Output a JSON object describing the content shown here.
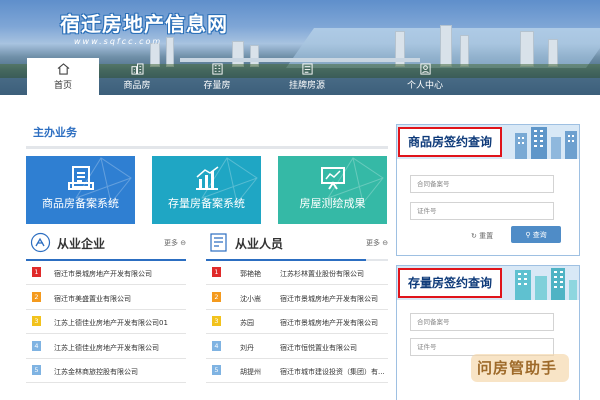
{
  "header": {
    "site_title": "宿迁房地产信息网",
    "site_url": "www.sqfcc.com",
    "nav": [
      {
        "label": "首页",
        "icon": "home-icon",
        "active": true
      },
      {
        "label": "商品房",
        "icon": "building-icon",
        "active": false
      },
      {
        "label": "存量房",
        "icon": "apartment-icon",
        "active": false
      },
      {
        "label": "挂牌房源",
        "icon": "listing-icon",
        "active": false
      },
      {
        "label": "个人中心",
        "icon": "user-icon",
        "active": false
      }
    ]
  },
  "main": {
    "section_title": "主办业务",
    "tiles": [
      {
        "label": "商品房备案系统",
        "icon": "document-icon",
        "color": "#2f7fd2"
      },
      {
        "label": "存量房备案系统",
        "icon": "bar-chart-icon",
        "color": "#1fa6c4"
      },
      {
        "label": "房屋测绘成果",
        "icon": "monitor-chart-icon",
        "color": "#35b9a6"
      }
    ]
  },
  "enterprises": {
    "title": "从业企业",
    "more_label": "更多",
    "rows": [
      {
        "rank": "1",
        "name": "宿迁市景城房地产开发有限公司"
      },
      {
        "rank": "2",
        "name": "宿迁市美盛置业有限公司"
      },
      {
        "rank": "3",
        "name": "江苏上德佳业房地产开发有限公司01"
      },
      {
        "rank": "4",
        "name": "江苏上德佳业房地产开发有限公司"
      },
      {
        "rank": "5",
        "name": "江苏金林商旅控股有限公司"
      }
    ]
  },
  "personnel": {
    "title": "从业人员",
    "more_label": "更多",
    "rows": [
      {
        "rank": "1",
        "person": "郭艳艳",
        "company": "江苏杉林置业股份有限公司"
      },
      {
        "rank": "2",
        "person": "沈小嵩",
        "company": "宿迁市景城房地产开发有限公司"
      },
      {
        "rank": "3",
        "person": "苏园",
        "company": "宿迁市景城房地产开发有限公司"
      },
      {
        "rank": "4",
        "person": "刘丹",
        "company": "宿迁市恒悦置业有限公司"
      },
      {
        "rank": "5",
        "person": "胡提州",
        "company": "宿迁市城市建设投资（集团）有..."
      }
    ]
  },
  "rank_colors": [
    "#e02a2a",
    "#f49a1e",
    "#f2c21c",
    "#7fb3e2",
    "#7fb3e2"
  ],
  "new_house_query": {
    "title": "商品房签约查询",
    "contract_placeholder": "合同备案号",
    "id_placeholder": "证件号",
    "reset_label": "重置",
    "query_label": "查询"
  },
  "stock_house_query": {
    "title": "存量房签约查询",
    "contract_placeholder": "合同备案号",
    "id_placeholder": "证件号"
  },
  "watermark": "问房管助手"
}
